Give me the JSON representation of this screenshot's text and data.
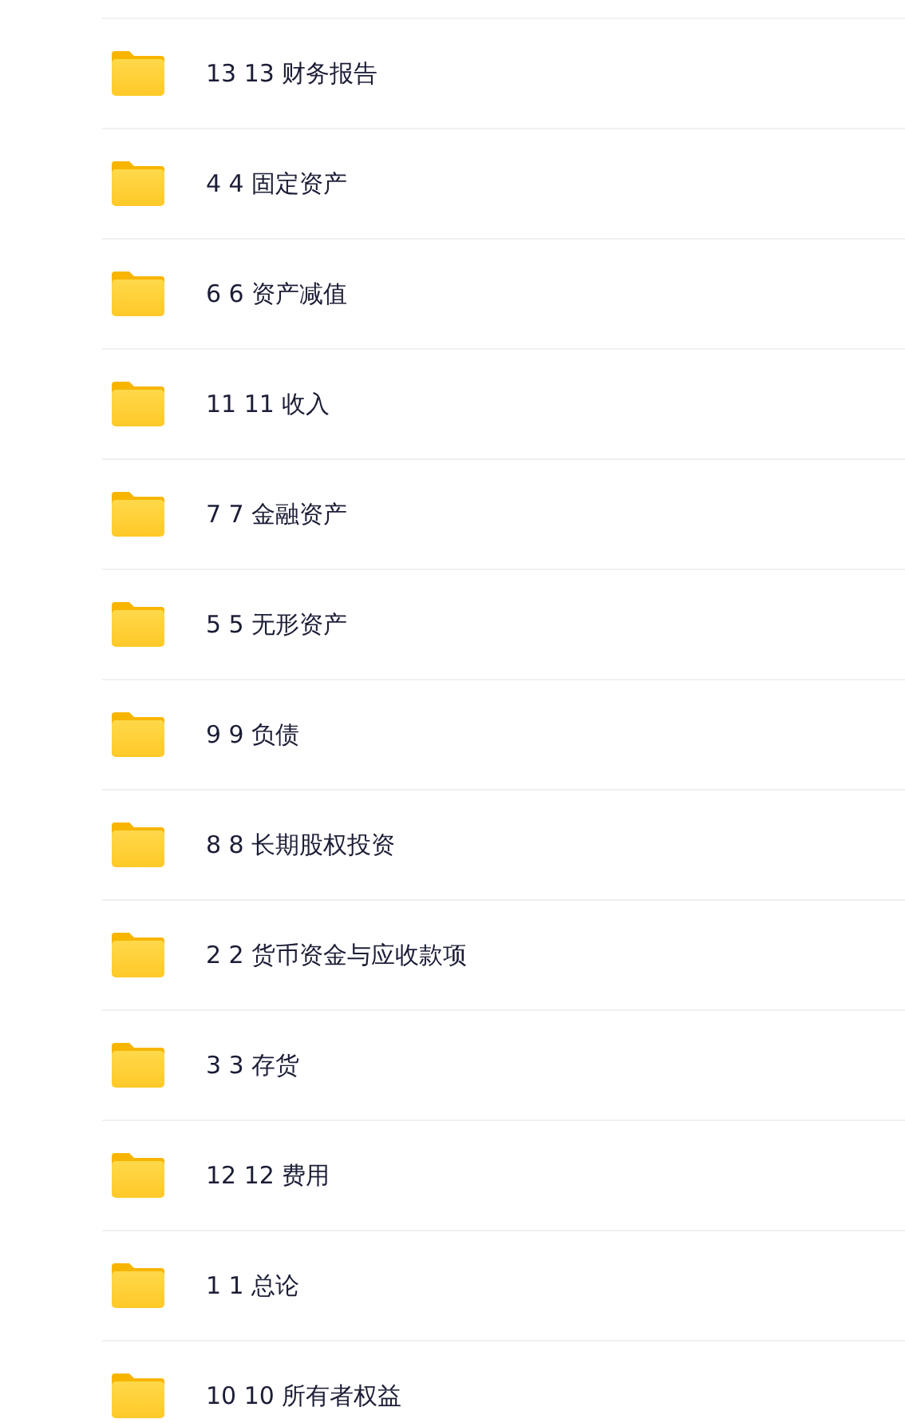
{
  "folders": [
    {
      "name": "13 13 财务报告"
    },
    {
      "name": "4 4 固定资产"
    },
    {
      "name": "6 6 资产减值"
    },
    {
      "name": "11 11 收入"
    },
    {
      "name": "7 7 金融资产"
    },
    {
      "name": "5 5 无形资产"
    },
    {
      "name": "9 9 负债"
    },
    {
      "name": "8 8 长期股权投资"
    },
    {
      "name": "2 2 货币资金与应收款项"
    },
    {
      "name": "3 3 存货"
    },
    {
      "name": "12 12 费用"
    },
    {
      "name": "1 1 总论"
    },
    {
      "name": "10 10 所有者权益"
    }
  ]
}
